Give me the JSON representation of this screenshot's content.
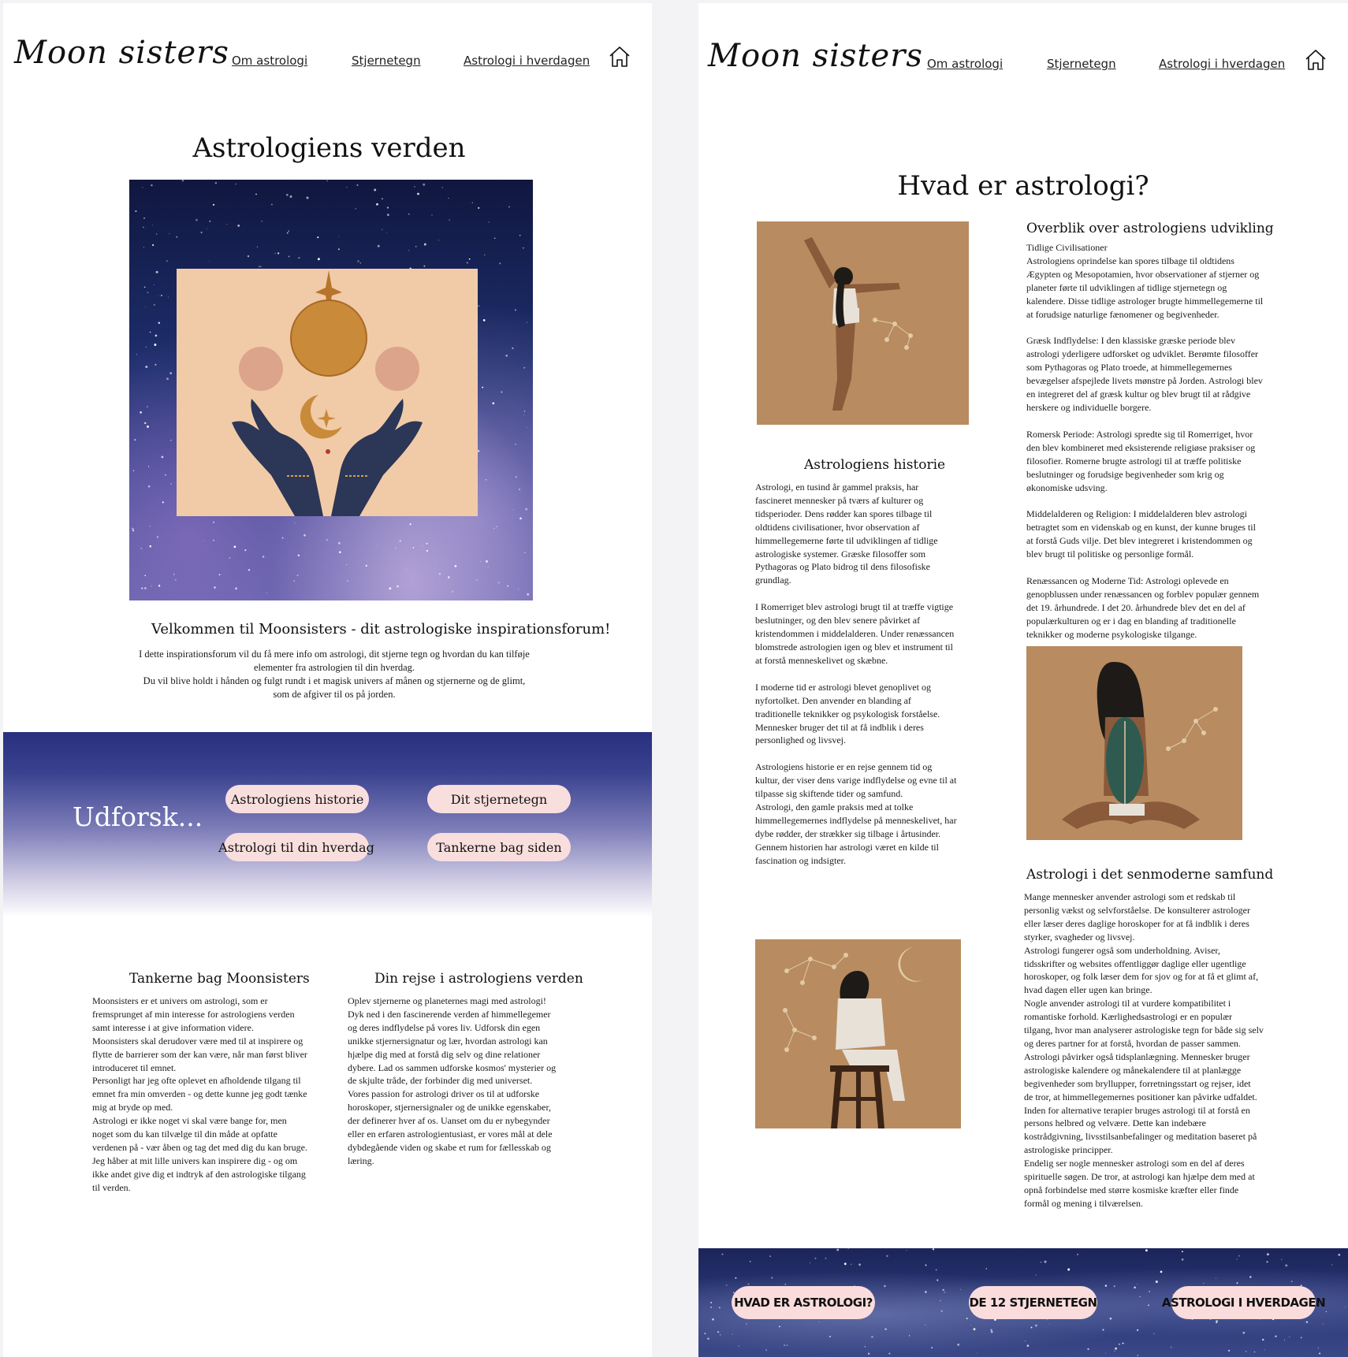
{
  "left_page": {
    "logo": "Moon sisters",
    "nav": [
      "Om astrologi",
      "Stjernetegn",
      "Astrologi i hverdagen"
    ],
    "title": "Astrologiens verden",
    "welcome_heading": "Velkommen til Moonsisters - dit astrologiske inspirationsforum!",
    "welcome_lines": [
      "I dette inspirationsforum vil du få mere info om astrologi, dit stjerne tegn og hvordan du kan tilføje",
      "elementer fra astrologien til din hverdag.",
      "Du vil blive holdt i hånden og fulgt rundt i et magisk univers af månen og stjernerne og de glimt,",
      "som de afgiver til os på jorden."
    ],
    "explore": {
      "title": "Udforsk...",
      "buttons": [
        "Astrologiens historie",
        "Dit stjernetegn",
        "Astrologi til din hverdag",
        "Tankerne bag siden"
      ]
    },
    "col1": {
      "heading": "Tankerne bag Moonsisters",
      "lines": [
        "Moonsisters er et univers om astrologi, som er",
        "fremsprunget af min interesse for astrologiens verden",
        "samt interesse i at give information videre.",
        "Moonsisters skal derudover være med til at inspirere og",
        "flytte de barrierer som der kan være, når man først bliver",
        "introduceret til emnet.",
        "Personligt har jeg ofte oplevet en afholdende tilgang til",
        "emnet fra min omverden - og dette kunne jeg godt tænke",
        "mig at bryde op med.",
        "Astrologi er ikke noget vi skal være bange for, men",
        "noget som du kan tilvælge til din måde at opfatte",
        "verdenen på - vær åben og tag det med dig du kan bruge.",
        "Jeg håber at mit lille univers kan inspirere dig - og om",
        "ikke andet give dig et indtryk af den astrologiske tilgang",
        "til verden."
      ]
    },
    "col2": {
      "heading": "Din rejse i astrologiens verden",
      "lines": [
        "Oplev stjernerne og planeternes magi med astrologi!",
        "Dyk ned i den fascinerende verden af himmellegemer",
        "og deres indflydelse på vores liv. Udforsk din egen",
        "unikke stjernersignatur og lær, hvordan astrologi kan",
        "hjælpe dig med at forstå dig selv og dine relationer",
        "dybere. Lad os sammen udforske kosmos' mysterier og",
        "de skjulte tråde, der forbinder dig med universet.",
        "Vores passion for astrologi driver os til at udforske",
        "horoskoper, stjernersignaler og de unikke egenskaber,",
        "der definerer hver af os. Uanset om du er nybegynder",
        "eller en erfaren astrologientusiast, er vores mål at dele",
        "dybdegående viden og skabe et rum for fællesskab og",
        "læring."
      ]
    }
  },
  "right_page": {
    "logo": "Moon sisters",
    "nav": [
      "Om astrologi",
      "Stjernetegn",
      "Astrologi i hverdagen"
    ],
    "title": "Hvad er astrologi?",
    "history": {
      "heading": "Astrologiens historie",
      "paragraphs": [
        [
          "Astrologi, en tusind år gammel praksis, har",
          "fascineret mennesker på tværs af kulturer og",
          "tidsperioder. Dens rødder kan spores tilbage til",
          "oldtidens civilisationer, hvor observation af",
          "himmellegemerne førte til udviklingen af tidlige",
          "astrologiske systemer. Græske filosoffer som",
          "Pythagoras og Plato bidrog til dens filosofiske",
          "grundlag."
        ],
        [
          "I Romerriget blev astrologi brugt til at træffe vigtige",
          "beslutninger, og den blev senere påvirket af",
          "kristendommen i middelalderen. Under renæssancen",
          "blomstrede astrologien igen og blev et instrument til",
          "at forstå menneskelivet og skæbne."
        ],
        [
          "I moderne tid er astrologi blevet genoplivet og",
          "nyfortolket. Den anvender en blanding af",
          "traditionelle teknikker og psykologisk forståelse.",
          "Mennesker bruger det til at få indblik i deres",
          "personlighed og livsvej."
        ],
        [
          "Astrologiens historie er en rejse gennem tid og",
          "kultur, der viser dens varige indflydelse og evne til at",
          "tilpasse sig skiftende tider og samfund.",
          "Astrologi, den gamle praksis med at tolke",
          "himmellegemernes indflydelse på menneskelivet, har",
          "dybe rødder, der strækker sig tilbage i årtusinder.",
          "Gennem historien har astrologi været en kilde til",
          "fascination og indsigter."
        ]
      ]
    },
    "overview": {
      "heading": "Overblik over astrologiens udvikling",
      "paragraphs": [
        [
          "Tidlige Civilisationer",
          "Astrologiens oprindelse kan spores tilbage til oldtidens",
          "Ægypten og Mesopotamien, hvor observationer af stjerner og",
          "planeter førte til udviklingen af tidlige stjernetegn og",
          "kalendere. Disse tidlige astrologer brugte himmellegemerne til",
          "at forudsige naturlige fænomener og begivenheder."
        ],
        [
          "Græsk Indflydelse: I den klassiske græske periode blev",
          "astrologi yderligere udforsket og udviklet. Berømte filosoffer",
          "som Pythagoras og Plato troede, at himmellegemernes",
          "bevægelser afspejlede livets mønstre på Jorden. Astrologi blev",
          "en integreret del af græsk kultur og blev brugt til at rådgive",
          "herskere og individuelle borgere."
        ],
        [
          "Romersk Periode: Astrologi spredte sig til Romerriget, hvor",
          "den blev kombineret med eksisterende religiøse praksiser og",
          "filosofier. Romerne brugte astrologi til at træffe politiske",
          "beslutninger og forudsige begivenheder som krig og",
          "økonomiske udsving."
        ],
        [
          "Middelalderen og Religion: I middelalderen blev astrologi",
          "betragtet som en videnskab og en kunst, der kunne bruges til",
          "at forstå Guds vilje. Det blev integreret i kristendommen og",
          "blev brugt til politiske og personlige formål."
        ],
        [
          "Renæssancen og Moderne Tid: Astrologi oplevede en",
          "genopblussen under renæssancen og forblev populær gennem",
          "det 19. århundrede. I det 20. århundrede blev det en del af",
          "populærkulturen og er i dag en blanding af traditionelle",
          "teknikker og moderne psykologiske tilgange."
        ]
      ]
    },
    "modern": {
      "heading": "Astrologi i det senmoderne samfund",
      "lines": [
        "Mange mennesker anvender astrologi som et redskab til",
        "personlig vækst og selvforståelse. De konsulterer astrologer",
        "eller læser deres daglige horoskoper for at få indblik i deres",
        "styrker, svagheder og livsvej.",
        "Astrologi fungerer også som underholdning. Aviser,",
        "tidsskrifter og websites offentliggør daglige eller ugentlige",
        "horoskoper, og folk læser dem for sjov og for at få et glimt af,",
        "hvad dagen eller ugen kan bringe.",
        "Nogle anvender astrologi til at vurdere kompatibilitet i",
        "romantiske forhold. Kærlighedsastrologi er en populær",
        "tilgang, hvor man analyserer astrologiske tegn for både sig selv",
        "og deres partner for at forstå, hvordan de passer sammen.",
        "Astrologi påvirker også tidsplanlægning. Mennesker bruger",
        "astrologiske kalendere og månekalendere til at planlægge",
        "begivenheder som bryllupper, forretningsstart og rejser, idet",
        "de tror, at himmellegemernes positioner kan påvirke udfaldet.",
        "Inden for alternative terapier bruges astrologi til at forstå en",
        "persons helbred og velvære. Dette kan indebære",
        "kostrådgivning, livsstilsanbefalinger og meditation baseret på",
        "astrologiske principper.",
        "Endelig ser nogle mennesker astrologi som en del af deres",
        "spirituelle søgen. De tror, at astrologi kan hjælpe dem med at",
        "opnå forbindelse med større kosmiske kræfter eller finde",
        "formål og mening i tilværelsen."
      ]
    },
    "footer_buttons": [
      "HVAD ER ASTROLOGI?",
      "DE 12 STJERNETEGN",
      "ASTROLOGI I HVERDAGEN"
    ]
  }
}
